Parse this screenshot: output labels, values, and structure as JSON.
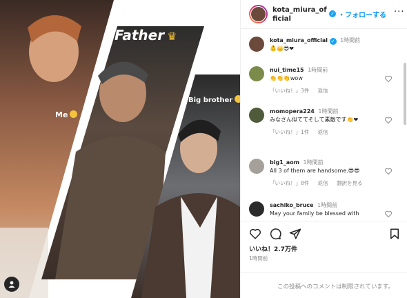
{
  "photo": {
    "labels": {
      "me": "Me",
      "father": "Father",
      "brother": "Big brother"
    }
  },
  "header": {
    "username": "kota_miura_official",
    "follow_label": "・フォローする",
    "more_label": "···"
  },
  "caption": {
    "username": "kota_miura_official",
    "time": "1時間前",
    "emojis": "👶👑😎❤"
  },
  "comments": [
    {
      "username": "nui_time15",
      "time": "1時間前",
      "text": "👏👏👏wow",
      "likes": "「いいね！」3件",
      "reply": "返信",
      "translate": ""
    },
    {
      "username": "momopera224",
      "time": "1時間前",
      "text": "みなさん似ててそして素敵です👏❤",
      "likes": "「いいね！」1件",
      "reply": "返信",
      "translate": ""
    },
    {
      "username": "big1_aom",
      "time": "1時間前",
      "text": "All 3 of them are handsome.😎😎",
      "likes": "「いいね！」8件",
      "reply": "返信",
      "translate": "翻訳を見る"
    },
    {
      "username": "sachiko_bruce",
      "time": "1時間前",
      "text": "May your family be blessed with",
      "likes": "",
      "reply": "",
      "translate": ""
    }
  ],
  "stats": {
    "likes": "いいね！2.7万件",
    "posted": "1時間前"
  },
  "footer": {
    "restricted": "この投稿へのコメントは制限されています。"
  },
  "colors": {
    "link": "#0095f6",
    "muted": "#8e8e8e",
    "verified": "#1da1f2"
  }
}
